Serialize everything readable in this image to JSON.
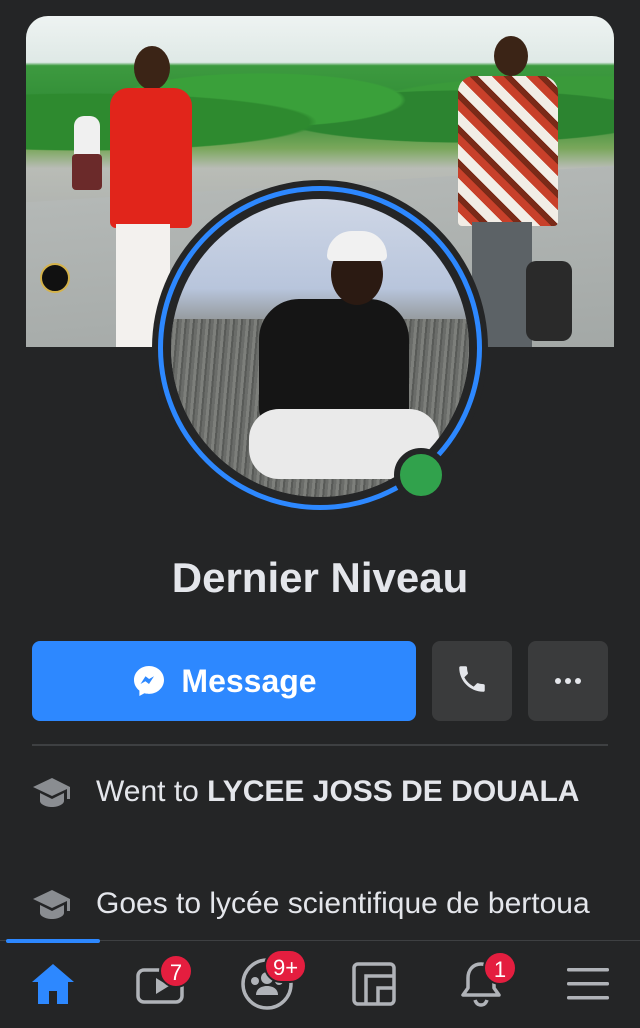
{
  "profile": {
    "name": "Dernier Niveau",
    "online": true
  },
  "actions": {
    "message_label": "Message",
    "call_icon": "phone-icon",
    "more_icon": "more-dots-icon"
  },
  "about": [
    {
      "icon": "education-cap-icon",
      "prefix": "Went to ",
      "highlight": "LYCEE JOSS DE DOUALA",
      "suffix": ""
    },
    {
      "icon": "education-cap-icon",
      "prefix": "Goes to lycée scientifique de bertoua",
      "highlight": "",
      "suffix": ""
    }
  ],
  "tabs": [
    {
      "name": "home",
      "icon": "home-icon",
      "badge": "",
      "active": true
    },
    {
      "name": "watch",
      "icon": "video-icon",
      "badge": "7",
      "active": false
    },
    {
      "name": "groups",
      "icon": "groups-icon",
      "badge": "9+",
      "active": false
    },
    {
      "name": "pages",
      "icon": "pages-icon",
      "badge": "",
      "active": false
    },
    {
      "name": "notifications",
      "icon": "bell-icon",
      "badge": "1",
      "active": false
    },
    {
      "name": "menu",
      "icon": "menu-icon",
      "badge": "",
      "active": false
    }
  ],
  "colors": {
    "background": "#242526",
    "accent": "#2d88ff",
    "online": "#31a24c",
    "badge": "#e41e3f",
    "secondary_button": "#3a3b3c"
  }
}
